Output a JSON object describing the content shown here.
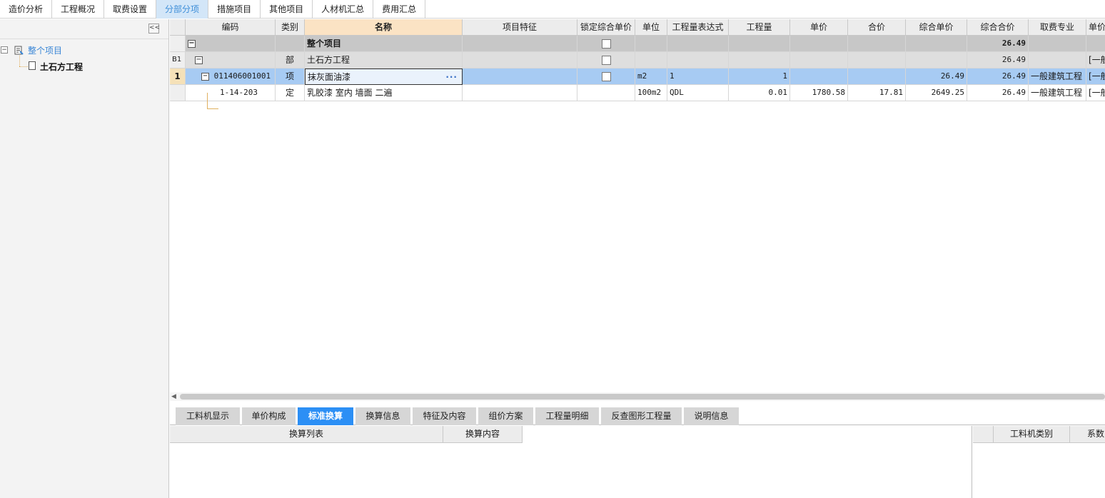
{
  "top_tabs": [
    "造价分析",
    "工程概况",
    "取费设置",
    "分部分项",
    "措施项目",
    "其他项目",
    "人材机汇总",
    "费用汇总"
  ],
  "top_tab_active": "分部分项",
  "tree": {
    "collapse_label": "<<",
    "root_toggle": "⊟",
    "root_label": "整个项目",
    "child_label": "土石方工程"
  },
  "grid": {
    "headers": [
      "编码",
      "类别",
      "名称",
      "项目特征",
      "锁定综合单价",
      "单位",
      "工程量表达式",
      "工程量",
      "单价",
      "合价",
      "综合单价",
      "综合合价",
      "取费专业",
      "单价"
    ],
    "rows": [
      {
        "type": "total",
        "row_number": "",
        "toggle": "−",
        "code": "",
        "category": "",
        "name": "整个项目",
        "feature": "",
        "unit": "",
        "expr": "",
        "qty": "",
        "price": "",
        "total": "",
        "comp_price": "",
        "comp_total": "26.49",
        "fee_type": "",
        "extra": ""
      },
      {
        "type": "section",
        "row_number": "B1",
        "toggle": "−",
        "code": "",
        "category": "部",
        "name": "土石方工程",
        "feature": "",
        "unit": "",
        "expr": "",
        "qty": "",
        "price": "",
        "total": "",
        "comp_price": "",
        "comp_total": "26.49",
        "fee_type": "",
        "extra": "[一般"
      },
      {
        "type": "item",
        "row_number": "1",
        "toggle": "−",
        "code": "011406001001",
        "category": "项",
        "name": "抹灰面油漆",
        "feature": "",
        "unit": "m2",
        "expr": "1",
        "qty": "1",
        "price": "",
        "total": "",
        "comp_price": "26.49",
        "comp_total": "26.49",
        "fee_type": "一般建筑工程",
        "extra": "[一般"
      },
      {
        "type": "quota",
        "row_number": "",
        "toggle": "",
        "code": "1-14-203",
        "category": "定",
        "name": "乳胶漆 室内 墙面 二遍",
        "feature": "",
        "unit": "100m2",
        "expr": "QDL",
        "qty": "0.01",
        "price": "1780.58",
        "total": "17.81",
        "comp_price": "2649.25",
        "comp_total": "26.49",
        "fee_type": "一般建筑工程",
        "extra": "[一般"
      }
    ]
  },
  "bottom_tabs": [
    "工料机显示",
    "单价构成",
    "标准换算",
    "换算信息",
    "特征及内容",
    "组价方案",
    "工程量明细",
    "反查图形工程量",
    "说明信息"
  ],
  "bottom_tab_active": "标准换算",
  "bottom_left_headers": [
    "换算列表",
    "换算内容"
  ],
  "bottom_right_headers": [
    "工料机类别",
    "系数"
  ],
  "colors": {
    "active_top_tab_bg": "#d3e6f8",
    "selected_row_bg": "#a7cbf3",
    "active_bottom_tab_bg": "#2c8ff5"
  }
}
